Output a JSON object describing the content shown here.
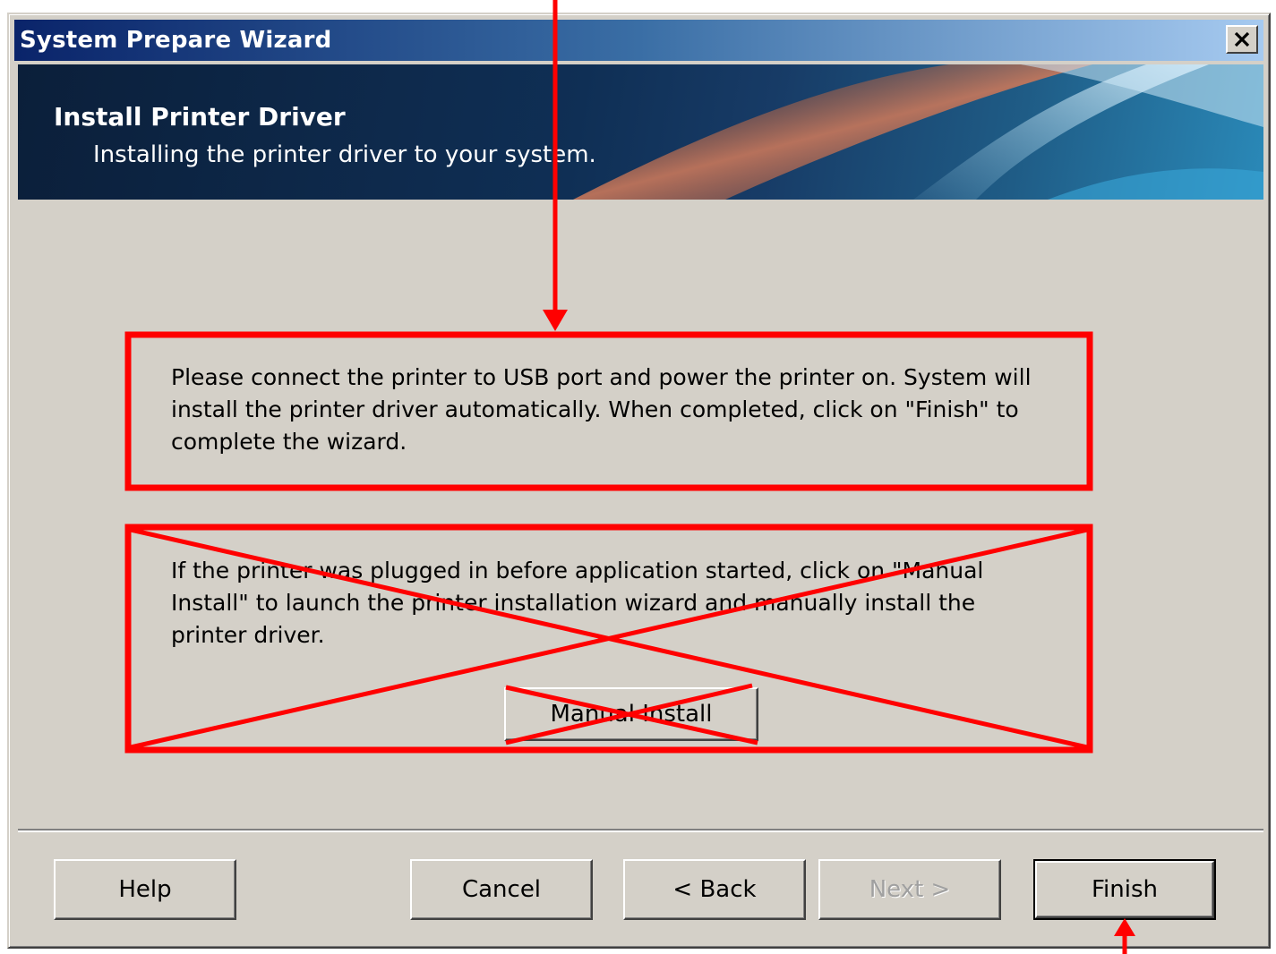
{
  "window": {
    "title": "System Prepare Wizard"
  },
  "banner": {
    "title": "Install Printer Driver",
    "subtitle": "Installing the printer driver to your system."
  },
  "content": {
    "instruction_text": "Please connect the printer to USB port and power the printer on. System will install the printer driver automatically. When completed, click on \"Finish\" to complete the wizard.",
    "manual_text": "If the printer was plugged in before application started, click on \"Manual Install\" to launch the printer installation wizard and manually install the printer driver.",
    "manual_install_label": "Manual Install"
  },
  "buttons": {
    "help": "Help",
    "cancel": "Cancel",
    "back": "< Back",
    "next": "Next >",
    "finish": "Finish"
  },
  "annotation": {
    "color": "#ff0000"
  },
  "colors": {
    "dialog_bg": "#d4d0c8",
    "title_gradient_start": "#0a246a",
    "title_gradient_end": "#a6caf0"
  }
}
